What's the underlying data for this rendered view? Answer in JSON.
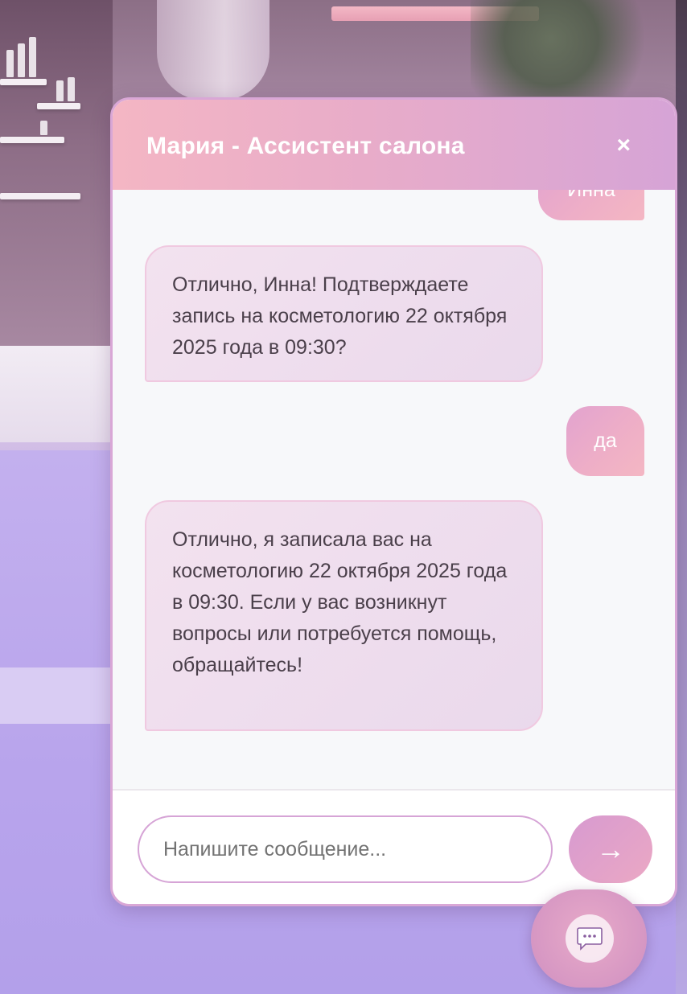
{
  "chat": {
    "title": "Мария - Ассистент салона",
    "close_label": "×",
    "messages": [
      {
        "role": "user",
        "text": "Инна"
      },
      {
        "role": "assistant",
        "text": "Отлично, Инна! Подтверждаете запись на косметологию 22 октября 2025 года в 09:30?"
      },
      {
        "role": "user",
        "text": "да"
      },
      {
        "role": "assistant",
        "text": "Отлично, я записала вас на косметологию 22 октября 2025 года в 09:30. Если у вас возникнут вопросы или потребуется помощь, обращайтесь!"
      }
    ],
    "input": {
      "placeholder": "Напишите сообщение...",
      "value": ""
    },
    "send_label": "→"
  },
  "launcher": {
    "icon": "chat-bubble-icon"
  },
  "colors": {
    "header_start": "#f4b6c4",
    "header_end": "#d6a4d6",
    "user_bubble": "#eeaec7",
    "bot_bubble": "#eedcee",
    "border": "#d9a7d6"
  }
}
